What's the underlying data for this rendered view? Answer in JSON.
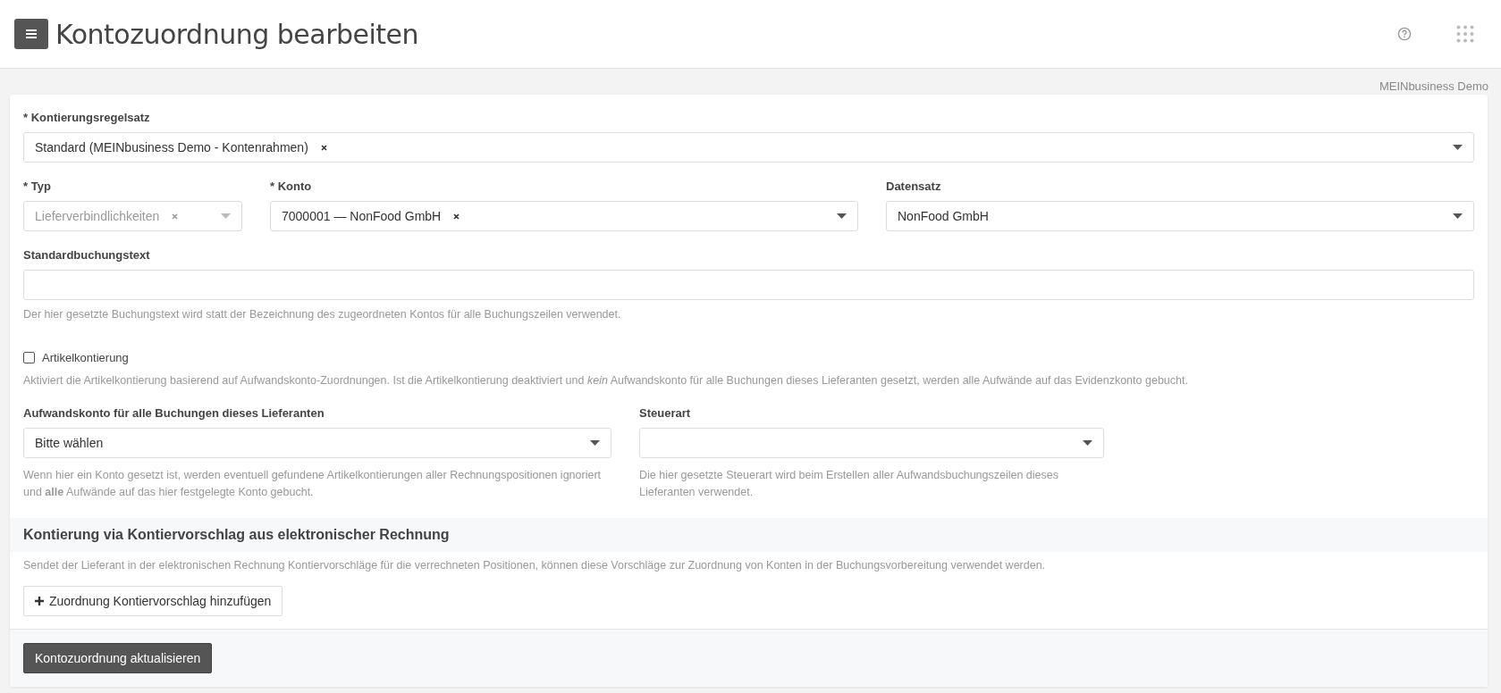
{
  "header": {
    "title": "Kontozuordnung bearbeiten"
  },
  "company": "MEINbusiness Demo",
  "rows": [
    {
      "fields": [
        {
          "kind": "select",
          "label": "* Kontierungsregelsatz",
          "value": "Standard (MEINbusiness Demo - Kontenrahmen)",
          "clearable": true,
          "disabled": false
        }
      ]
    },
    {
      "fields": [
        {
          "kind": "select",
          "label": "* Typ",
          "value": "Lieferverbindlichkeiten",
          "clearable": true,
          "disabled": true
        },
        {
          "kind": "select",
          "label": "* Konto",
          "value": "7000001 — NonFood GmbH",
          "clearable": true,
          "disabled": false
        },
        {
          "kind": "select",
          "label": "Datensatz",
          "value": "NonFood GmbH",
          "clearable": false,
          "disabled": false
        }
      ]
    },
    {
      "fields": [
        {
          "kind": "text",
          "label": "Standardbuchungstext",
          "help": "Der hier gesetzte Buchungstext wird statt der Bezeichnung des zugeordneten Kontos für alle Buchungszeilen verwendet."
        }
      ]
    },
    {
      "fields": [
        {
          "kind": "checkbox",
          "label": "Artikelkontierung",
          "checked": false,
          "help": "Aktiviert die Artikelkontierung basierend auf Aufwandskonto-Zuordnungen. Ist die Artikelkontierung deaktiviert und *kein* Aufwandskonto für alle Buchungen dieses Lieferanten gesetzt, werden alle Aufwände auf das Evidenzkonto gebucht."
        }
      ]
    },
    {
      "fields": [
        {
          "kind": "select",
          "label": "Aufwandskonto für alle Buchungen dieses Lieferanten",
          "value": "Bitte wählen",
          "clearable": false,
          "disabled": false,
          "help": "Wenn hier ein Konto gesetzt ist, werden eventuell gefundene Artikelkontierungen aller Rechnungspositionen ignoriert und **alle** Aufwände auf das hier festgelegte Konto gebucht."
        },
        {
          "kind": "select",
          "label": "Steuerart",
          "clearable": false,
          "disabled": false,
          "help": "Die hier gesetzte Steuerart wird beim Erstellen aller Aufwandsbuchungszeilen dieses Lieferanten verwendet."
        }
      ]
    }
  ],
  "section": {
    "title": "Kontierung via Kontiervorschlag aus elektronischer Rechnung",
    "help": "Sendet der Lieferant in der elektronischen Rechnung Kontiervorschläge für die verrechneten Positionen, können diese Vorschläge zur Zuordnung von Konten in der Buchungsvorbereitung verwendet werden.",
    "add_button": "Zuordnung Kontiervorschlag hinzufügen"
  },
  "submit_button": "Kontozuordnung aktualisieren"
}
